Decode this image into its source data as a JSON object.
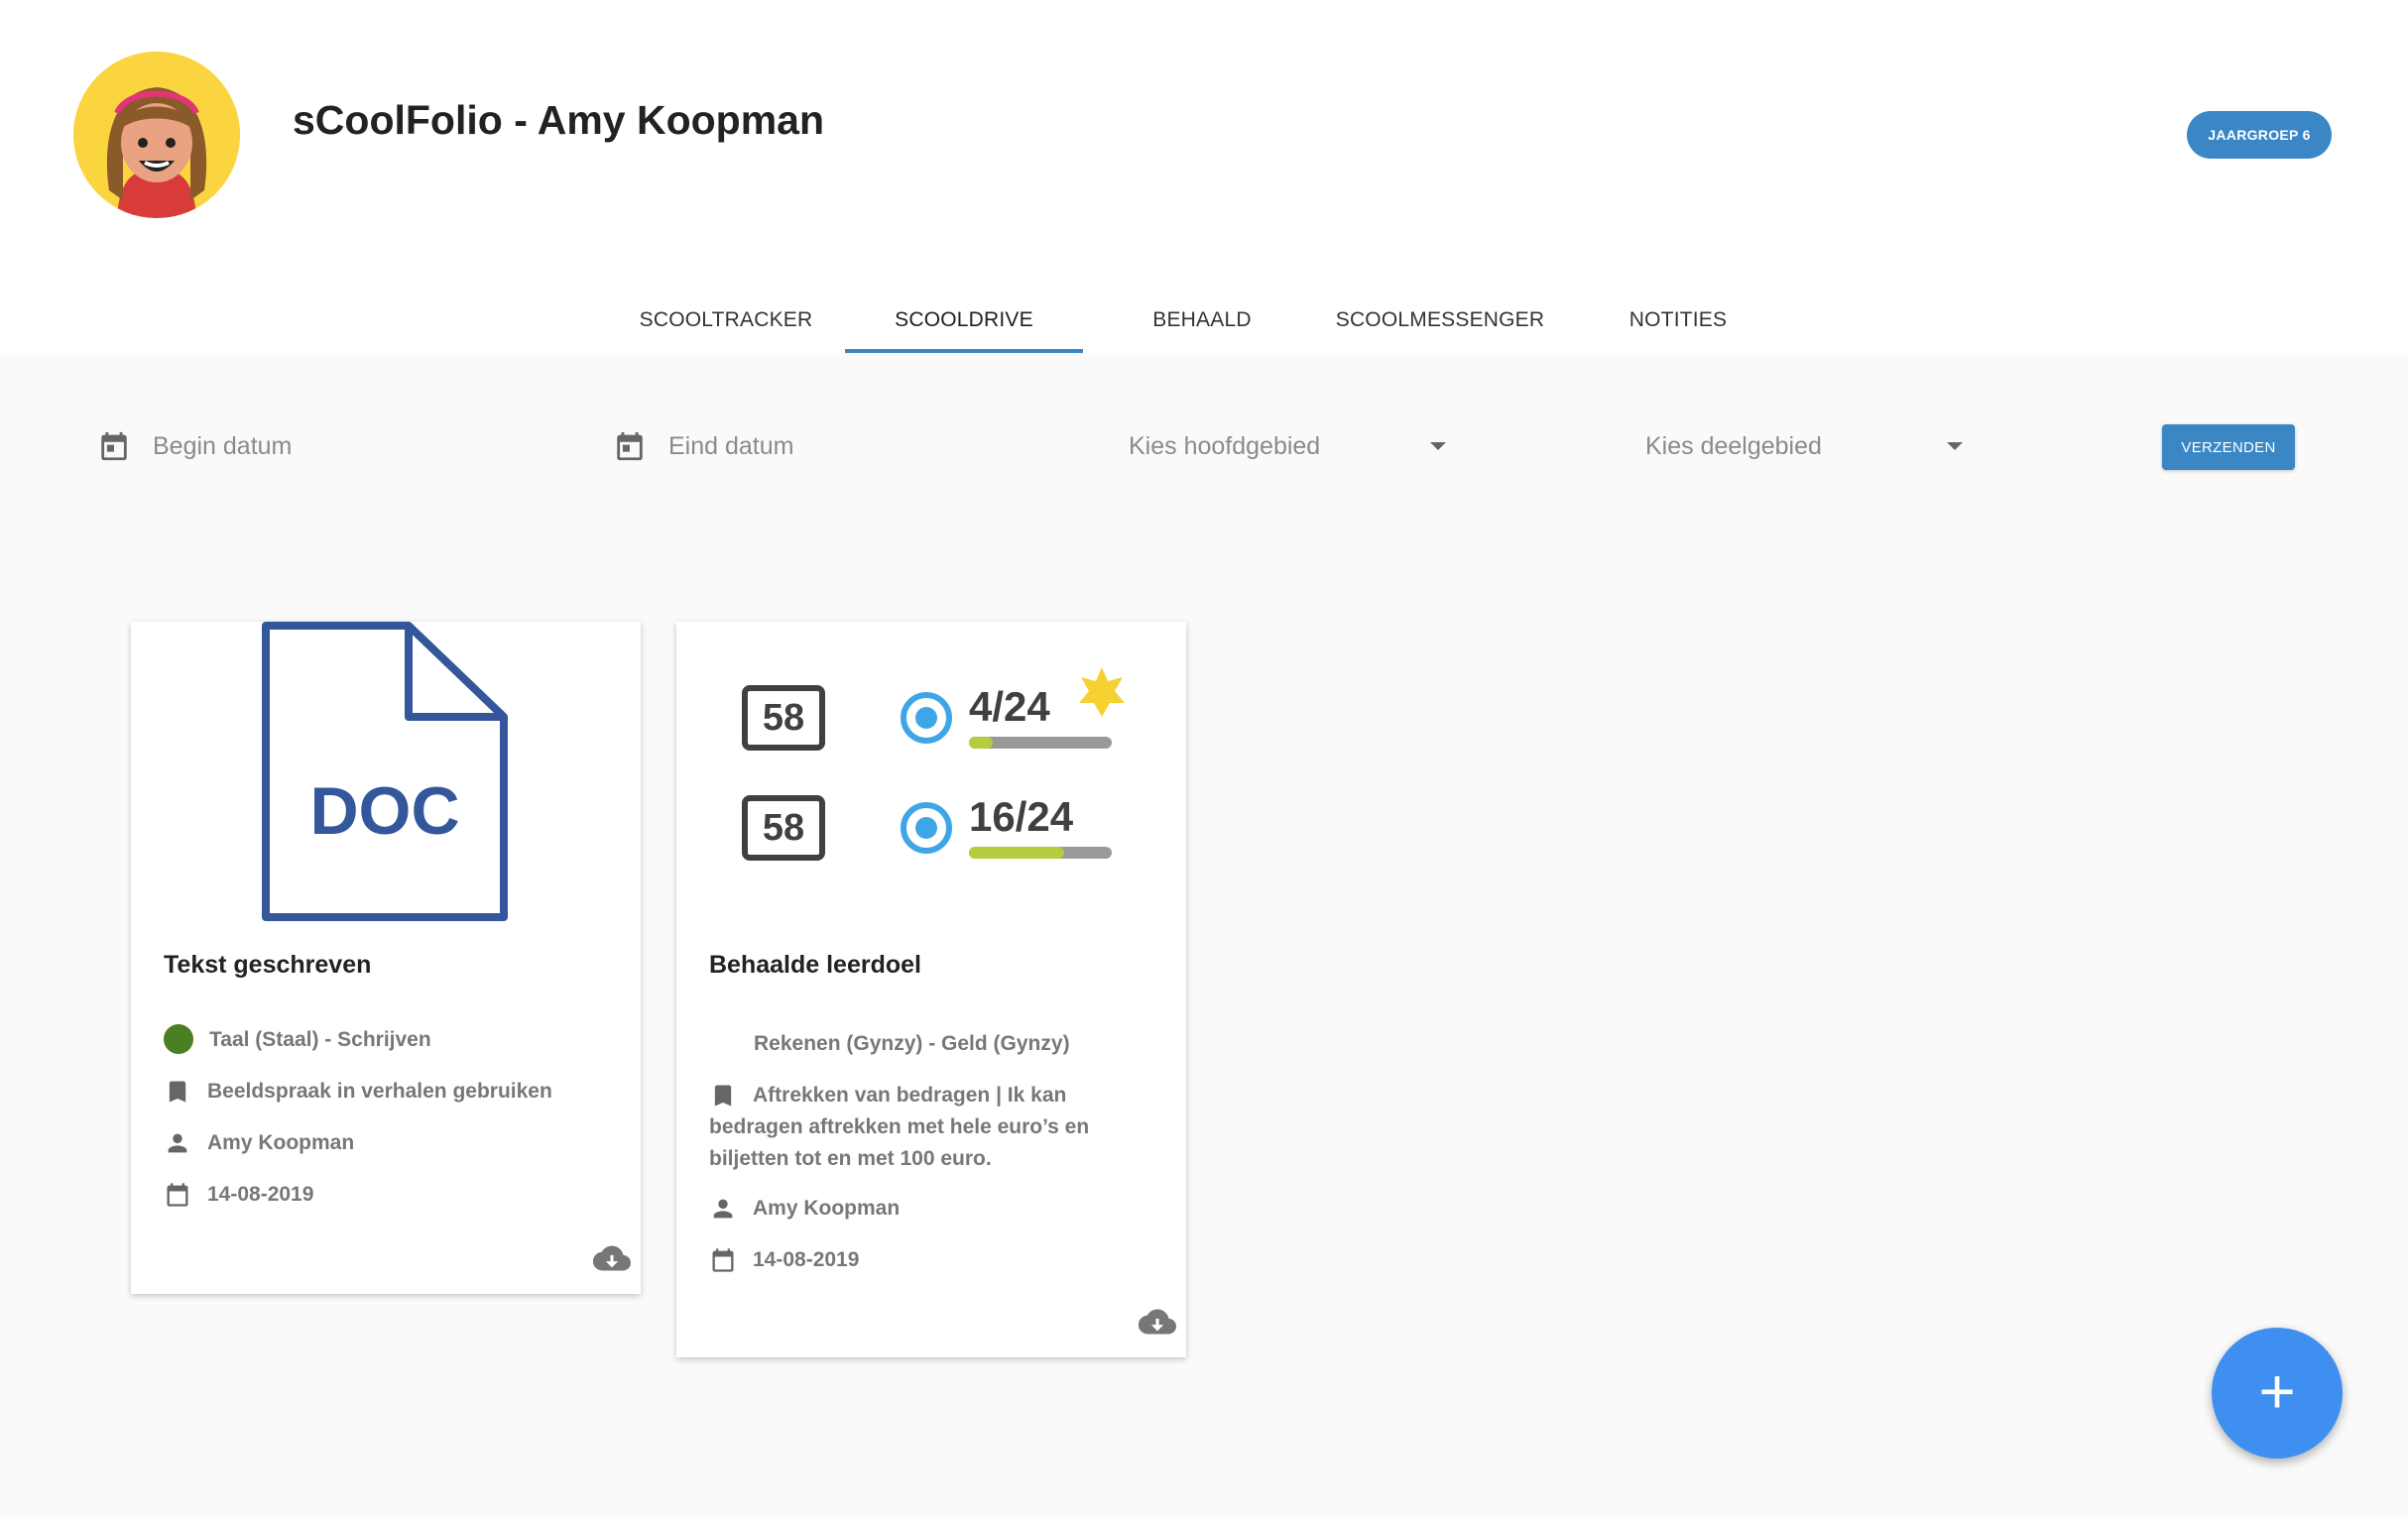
{
  "header": {
    "title": "sCoolFolio - Amy Koopman",
    "badge": "JAARGROEP 6",
    "avatar_icon": "student-avatar"
  },
  "tabs": [
    {
      "label": "SCOOLTRACKER",
      "active": false
    },
    {
      "label": "SCOOLDRIVE",
      "active": true
    },
    {
      "label": "BEHAALD",
      "active": false
    },
    {
      "label": "SCOOLMESSENGER",
      "active": false
    },
    {
      "label": "NOTITIES",
      "active": false
    }
  ],
  "filters": {
    "begin_placeholder": "Begin datum",
    "end_placeholder": "Eind datum",
    "hoofdgebied_placeholder": "Kies hoofdgebied",
    "deelgebied_placeholder": "Kies deelgebied",
    "send_label": "VERZENDEN"
  },
  "cards": [
    {
      "thumbnail_label": "DOC",
      "title": "Tekst geschreven",
      "subject": "Taal (Staal) - Schrijven",
      "subject_color": "#4a7f23",
      "goal": "Beeldspraak in verhalen gebruiken",
      "person": "Amy Koopman",
      "date": "14-08-2019"
    },
    {
      "stats": [
        {
          "box": "58",
          "progress": "4/24",
          "fraction": 0.1667
        },
        {
          "box": "58",
          "progress": "16/24",
          "fraction": 0.6667
        }
      ],
      "title": "Behaalde leerdoel",
      "subject": "Rekenen (Gynzy) - Geld (Gynzy)",
      "goal": "Aftrekken van bedragen | Ik kan bedragen aftrekken met hele euro’s en biljetten tot en met 100 euro.",
      "person": "Amy Koopman",
      "date": "14-08-2019"
    }
  ],
  "fab": {
    "label": "+"
  },
  "colors": {
    "accent": "#3b87c6",
    "fab": "#3f8ff0",
    "progress": "#b5cc3e"
  }
}
